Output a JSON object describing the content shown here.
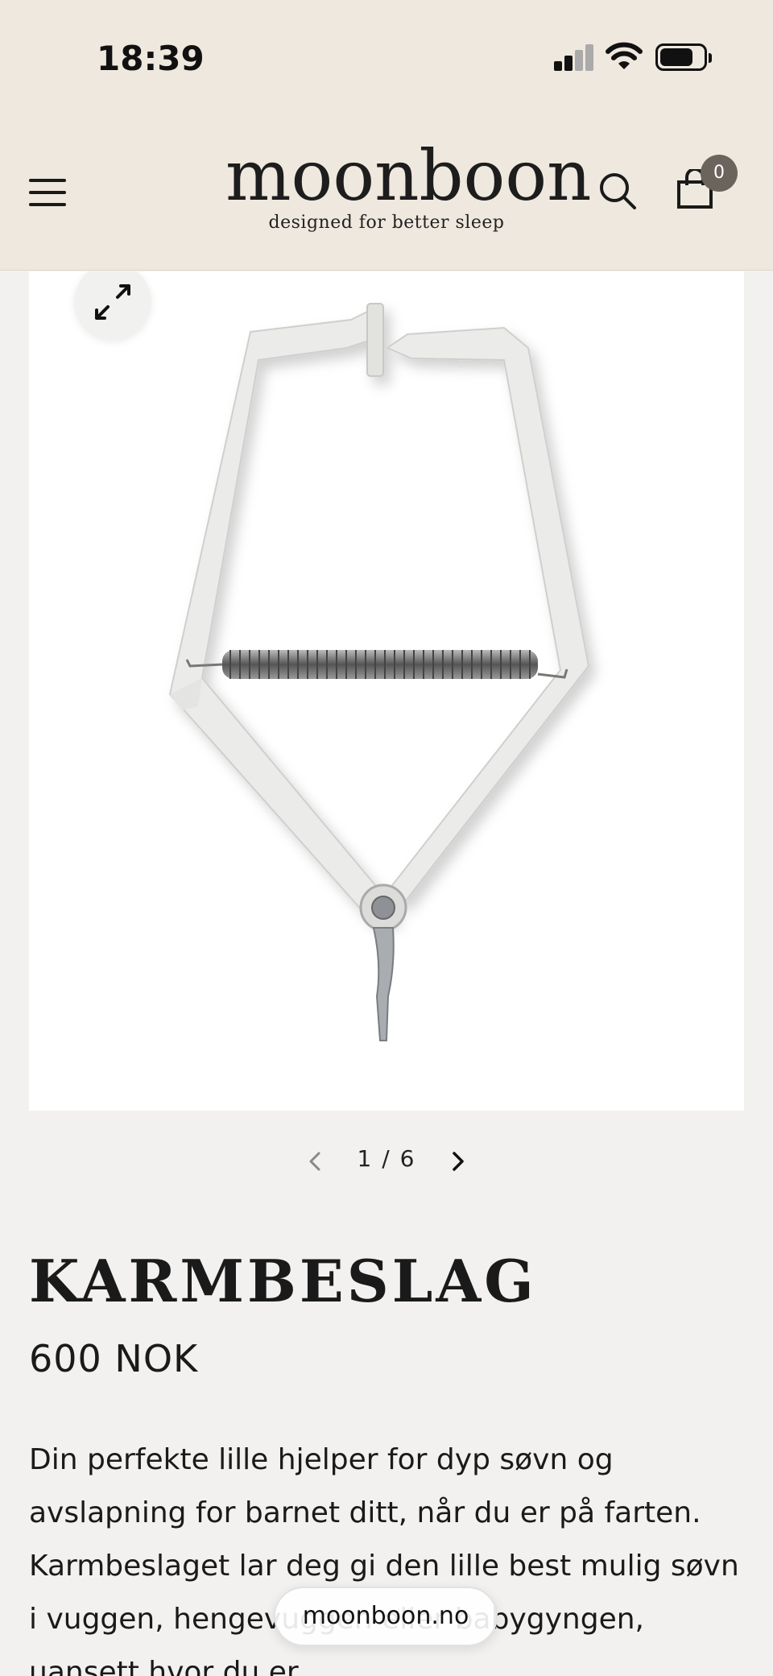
{
  "status_bar": {
    "time": "18:39"
  },
  "header": {
    "logo_name": "moonboon",
    "logo_tagline": "designed for better sleep",
    "cart_count": "0",
    "background": "#efe8de",
    "icons": [
      "menu-icon",
      "search-icon",
      "shopping-bag-icon"
    ]
  },
  "gallery": {
    "current": "1",
    "separator": "/",
    "total": "6",
    "icons": [
      "expand-icon",
      "chevron-left-icon",
      "chevron-right-icon"
    ]
  },
  "product": {
    "title": "KARMBESLAG",
    "price": "600 NOK",
    "description": "Din perfekte lille hjelper for dyp søvn og avslapning for barnet ditt, når du er på farten. Karmbeslaget lar deg gi den lille best mulig søvn i vuggen, hengevuggen eller babygyngen, uansett hvor du er."
  },
  "browser": {
    "url": "moonboon.no"
  }
}
